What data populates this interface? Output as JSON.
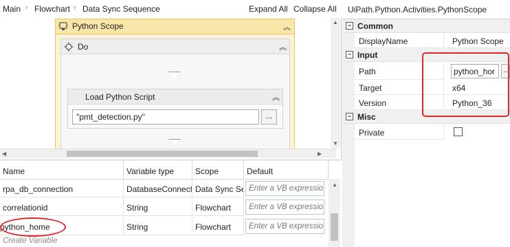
{
  "breadcrumb": [
    "Main",
    "Flowchart",
    "Data Sync Sequence"
  ],
  "toolbar": {
    "expand_all": "Expand All",
    "collapse_all": "Collapse All"
  },
  "activities": {
    "python_scope": "Python Scope",
    "do": "Do",
    "load_script": "Load Python Script",
    "script_value": "\"pmt_detection.py\"",
    "ellipsis": "..."
  },
  "variables": {
    "headers": [
      "Name",
      "Variable type",
      "Scope",
      "Default"
    ],
    "rows": [
      {
        "name": "rpa_db_connection",
        "type": "DatabaseConnecti",
        "scope": "Data Sync Sec",
        "default": "Enter a VB expressio"
      },
      {
        "name": "correlationid",
        "type": "String",
        "scope": "Flowchart",
        "default": "Enter a VB expressio"
      },
      {
        "name": "python_home",
        "type": "String",
        "scope": "Flowchart",
        "default": "Enter a VB expressio"
      }
    ],
    "create_label": "Create Variable"
  },
  "properties": {
    "title": "UiPath.Python.Activities.PythonScope",
    "categories": {
      "common": "Common",
      "input": "Input",
      "misc": "Misc"
    },
    "display_name_label": "DisplayName",
    "display_name_value": "Python Scope",
    "path_label": "Path",
    "path_value": "python_hor",
    "target_label": "Target",
    "target_value": "x64",
    "version_label": "Version",
    "version_value": "Python_36",
    "private_label": "Private",
    "private_checked": false,
    "toggle_symbol": "⊟",
    "ellipsis": ".."
  },
  "colors": {
    "highlight": "#e0262a",
    "scope_bg": "#fcf3d6"
  }
}
